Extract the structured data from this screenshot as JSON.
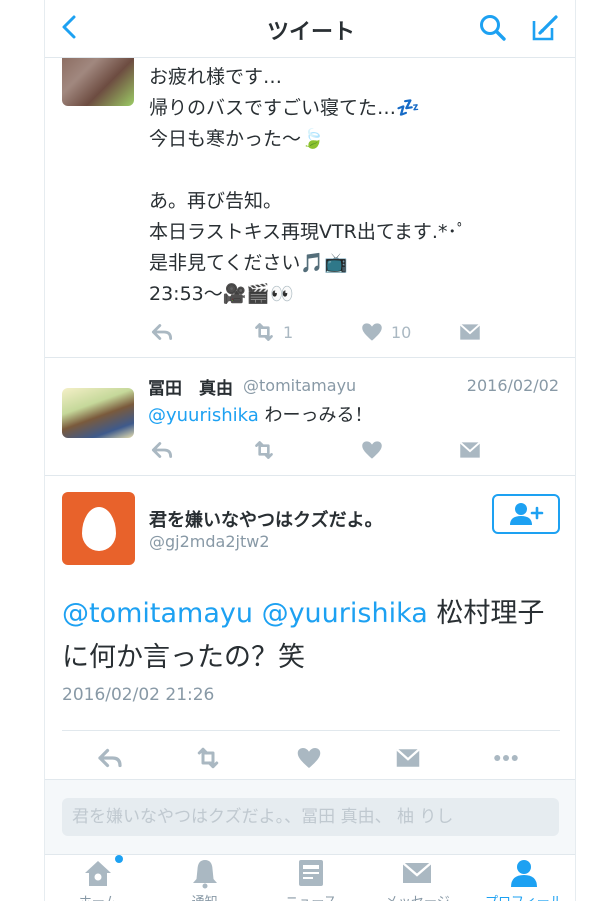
{
  "colors": {
    "accent": "#1da1f2",
    "icon_gray": "#aab8c2",
    "egg_avatar": "#e8622b"
  },
  "navbar": {
    "title": "ツイート",
    "icons": [
      "chevron-left-icon",
      "search-icon",
      "compose-icon"
    ]
  },
  "tweet1": {
    "text": "お疲れ様です…\n帰りのバスですごい寝てた…💤\n今日も寒かった〜🍃\n\nあ。再び告知。\n本日ラストキス再現VTR出てます.*･ﾟ\n是非見てください🎵📺\n23:53〜🎥🎬👀",
    "actions": {
      "retweet_count": "1",
      "like_count": "10"
    }
  },
  "tweet2": {
    "name": "冨田　真由",
    "handle": "@tomitamayu",
    "date": "2016/02/02",
    "mention": "@yuurishika",
    "text": " わーっみる！"
  },
  "main_tweet": {
    "name": "君を嫌いなやつはクズだよ。",
    "handle": "@gj2mda2jtw2",
    "mention1": "@tomitamayu",
    "mention2": "@yuurishika",
    "text": " 松村理子に何か言ったの？笑",
    "timestamp": "2016/02/02 21:26"
  },
  "reply": {
    "placeholder": "君を嫌いなやつはクズだよ。、冨田 真由、 柚 りし"
  },
  "tabbar": {
    "tabs": [
      {
        "label": "ホーム",
        "icon": "home-icon"
      },
      {
        "label": "通知",
        "icon": "bell-icon"
      },
      {
        "label": "ニュース",
        "icon": "news-icon"
      },
      {
        "label": "メッセージ",
        "icon": "envelope-icon"
      },
      {
        "label": "プロフィール",
        "icon": "person-icon",
        "active": true
      }
    ]
  }
}
